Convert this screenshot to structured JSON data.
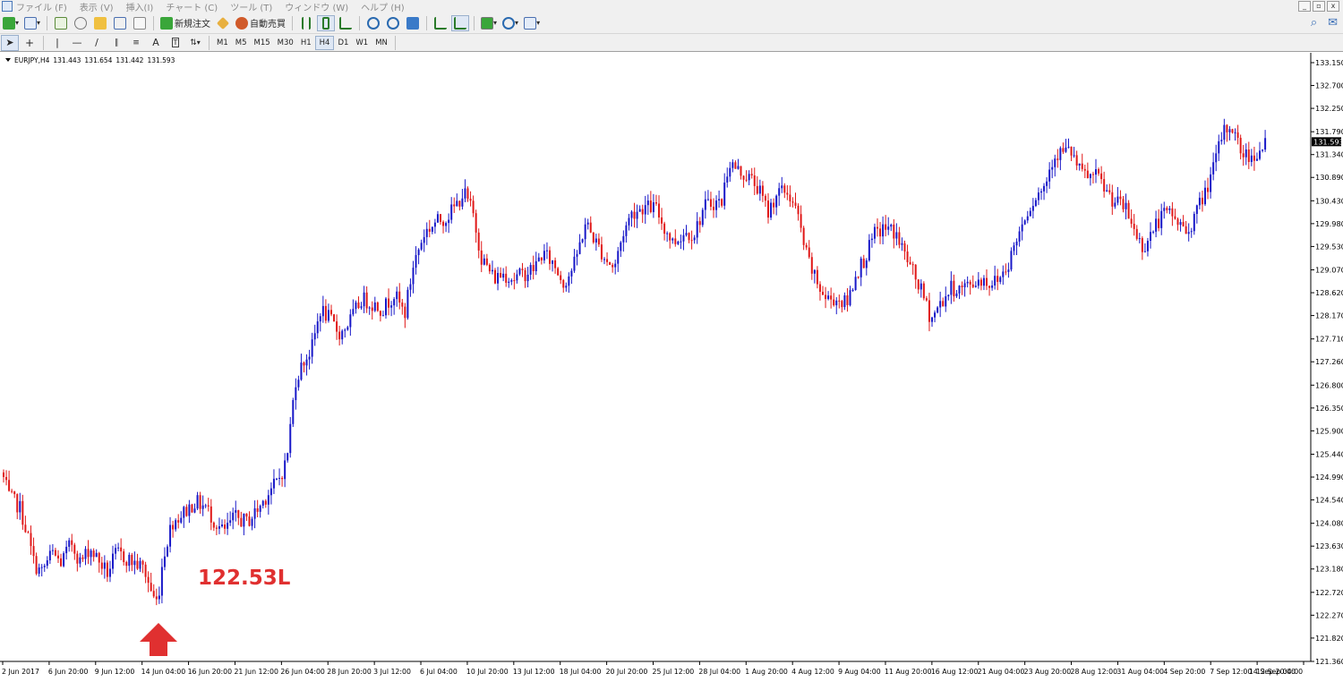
{
  "menubar": {
    "items": [
      "ファイル (F)",
      "表示 (V)",
      "挿入(I)",
      "チャート (C)",
      "ツール (T)",
      "ウィンドウ (W)",
      "ヘルプ (H)"
    ],
    "window_buttons": [
      "_",
      "▫",
      "x"
    ]
  },
  "toolbar1": {
    "new_order_label": "新規注文",
    "auto_trade_label": "自動売買"
  },
  "toolbar2": {
    "timeframes": [
      "M1",
      "M5",
      "M15",
      "M30",
      "H1",
      "H4",
      "D1",
      "W1",
      "MN"
    ],
    "active_timeframe": "H4",
    "text_tool_label": "A"
  },
  "chart": {
    "header": {
      "symbol": "EURJPY,H4",
      "open": "131.443",
      "high": "131.654",
      "low": "131.442",
      "close": "131.593"
    },
    "current_price_tag": "131.593",
    "annotation": {
      "label": "122.53L",
      "color": "#e03030"
    },
    "colors": {
      "bull": "#1818c8",
      "bear": "#e01818",
      "axis_text": "#000000",
      "price_tag_bg": "#000000"
    }
  },
  "chart_data": {
    "type": "candlestick",
    "symbol": "EURJPY",
    "timeframe": "H4",
    "y_ticks": [
      "133.150",
      "132.700",
      "132.250",
      "131.790",
      "131.340",
      "130.890",
      "130.430",
      "129.980",
      "129.530",
      "129.070",
      "128.620",
      "128.170",
      "127.710",
      "127.260",
      "126.800",
      "126.350",
      "125.900",
      "125.440",
      "124.990",
      "124.540",
      "124.080",
      "123.630",
      "123.180",
      "122.720",
      "122.270",
      "121.820",
      "121.360"
    ],
    "ylim": [
      121.36,
      133.15
    ],
    "x_ticks": [
      "2 Jun 2017",
      "6 Jun 20:00",
      "9 Jun 12:00",
      "14 Jun 04:00",
      "16 Jun 20:00",
      "21 Jun 12:00",
      "26 Jun 04:00",
      "28 Jun 20:00",
      "3 Jul 12:00",
      "6 Jul 04:00",
      "10 Jul 20:00",
      "13 Jul 12:00",
      "18 Jul 04:00",
      "20 Jul 20:00",
      "25 Jul 12:00",
      "28 Jul 04:00",
      "1 Aug 20:00",
      "4 Aug 12:00",
      "9 Aug 04:00",
      "11 Aug 20:00",
      "16 Aug 12:00",
      "21 Aug 04:00",
      "23 Aug 20:00",
      "28 Aug 12:00",
      "31 Aug 04:00",
      "4 Sep 20:00",
      "7 Sep 12:00",
      "12 Sep 04:00",
      "14 Sep 20:00"
    ],
    "path_points": [
      [
        0,
        125.2
      ],
      [
        10,
        124.6
      ],
      [
        22,
        124.4
      ],
      [
        30,
        123.9
      ],
      [
        38,
        123.3
      ],
      [
        46,
        123.1
      ],
      [
        58,
        123.5
      ],
      [
        68,
        123.3
      ],
      [
        80,
        123.7
      ],
      [
        90,
        123.3
      ],
      [
        100,
        123.6
      ],
      [
        112,
        123.3
      ],
      [
        120,
        123.1
      ],
      [
        130,
        123.5
      ],
      [
        140,
        123.4
      ],
      [
        150,
        123.3
      ],
      [
        160,
        123.2
      ],
      [
        172,
        122.6
      ],
      [
        176,
        122.53
      ],
      [
        182,
        123.4
      ],
      [
        192,
        124.1
      ],
      [
        206,
        124.3
      ],
      [
        218,
        124.5
      ],
      [
        230,
        124.4
      ],
      [
        240,
        124.1
      ],
      [
        250,
        123.9
      ],
      [
        262,
        124.2
      ],
      [
        276,
        124.1
      ],
      [
        290,
        124.4
      ],
      [
        300,
        124.7
      ],
      [
        310,
        124.9
      ],
      [
        320,
        125.3
      ],
      [
        330,
        126.9
      ],
      [
        340,
        127.3
      ],
      [
        348,
        127.5
      ],
      [
        358,
        128.3
      ],
      [
        368,
        128.1
      ],
      [
        380,
        127.8
      ],
      [
        392,
        128.1
      ],
      [
        404,
        128.5
      ],
      [
        416,
        128.4
      ],
      [
        428,
        128.3
      ],
      [
        440,
        128.6
      ],
      [
        452,
        128.2
      ],
      [
        462,
        129.2
      ],
      [
        474,
        129.8
      ],
      [
        486,
        130.0
      ],
      [
        498,
        130.1
      ],
      [
        508,
        130.3
      ],
      [
        518,
        130.6
      ],
      [
        528,
        130.2
      ],
      [
        538,
        129.3
      ],
      [
        552,
        128.9
      ],
      [
        562,
        129.0
      ],
      [
        574,
        128.9
      ],
      [
        586,
        129.0
      ],
      [
        596,
        129.1
      ],
      [
        606,
        129.4
      ],
      [
        618,
        129.2
      ],
      [
        630,
        128.8
      ],
      [
        642,
        129.2
      ],
      [
        654,
        130.0
      ],
      [
        666,
        129.6
      ],
      [
        676,
        129.3
      ],
      [
        686,
        129.1
      ],
      [
        696,
        129.8
      ],
      [
        706,
        130.2
      ],
      [
        718,
        130.3
      ],
      [
        732,
        130.3
      ],
      [
        742,
        129.9
      ],
      [
        752,
        129.6
      ],
      [
        764,
        129.8
      ],
      [
        776,
        129.8
      ],
      [
        786,
        130.3
      ],
      [
        796,
        130.4
      ],
      [
        806,
        130.4
      ],
      [
        814,
        131.2
      ],
      [
        826,
        131.0
      ],
      [
        836,
        130.9
      ],
      [
        846,
        130.7
      ],
      [
        858,
        130.2
      ],
      [
        868,
        130.6
      ],
      [
        880,
        130.6
      ],
      [
        890,
        130.2
      ],
      [
        900,
        129.4
      ],
      [
        910,
        128.9
      ],
      [
        922,
        128.5
      ],
      [
        934,
        128.5
      ],
      [
        946,
        128.4
      ],
      [
        956,
        129.0
      ],
      [
        966,
        129.3
      ],
      [
        978,
        129.8
      ],
      [
        990,
        129.9
      ],
      [
        1000,
        129.8
      ],
      [
        1010,
        129.4
      ],
      [
        1020,
        129.0
      ],
      [
        1030,
        128.6
      ],
      [
        1040,
        128.1
      ],
      [
        1050,
        128.4
      ],
      [
        1062,
        128.7
      ],
      [
        1074,
        128.7
      ],
      [
        1086,
        128.8
      ],
      [
        1096,
        128.9
      ],
      [
        1106,
        128.8
      ],
      [
        1116,
        128.9
      ],
      [
        1126,
        129.2
      ],
      [
        1136,
        129.7
      ],
      [
        1146,
        130.2
      ],
      [
        1156,
        130.5
      ],
      [
        1166,
        130.7
      ],
      [
        1176,
        131.3
      ],
      [
        1186,
        131.4
      ],
      [
        1196,
        131.4
      ],
      [
        1206,
        131.0
      ],
      [
        1216,
        130.9
      ],
      [
        1226,
        130.9
      ],
      [
        1236,
        130.6
      ],
      [
        1246,
        130.4
      ],
      [
        1256,
        130.3
      ],
      [
        1266,
        129.9
      ],
      [
        1276,
        129.5
      ],
      [
        1286,
        129.8
      ],
      [
        1296,
        130.1
      ],
      [
        1306,
        130.2
      ],
      [
        1316,
        130.0
      ],
      [
        1326,
        129.8
      ],
      [
        1336,
        130.2
      ],
      [
        1346,
        130.6
      ],
      [
        1356,
        131.1
      ],
      [
        1366,
        131.8
      ],
      [
        1376,
        131.9
      ],
      [
        1386,
        131.4
      ],
      [
        1396,
        131.3
      ],
      [
        1406,
        131.4
      ],
      [
        1414,
        131.59
      ]
    ]
  }
}
